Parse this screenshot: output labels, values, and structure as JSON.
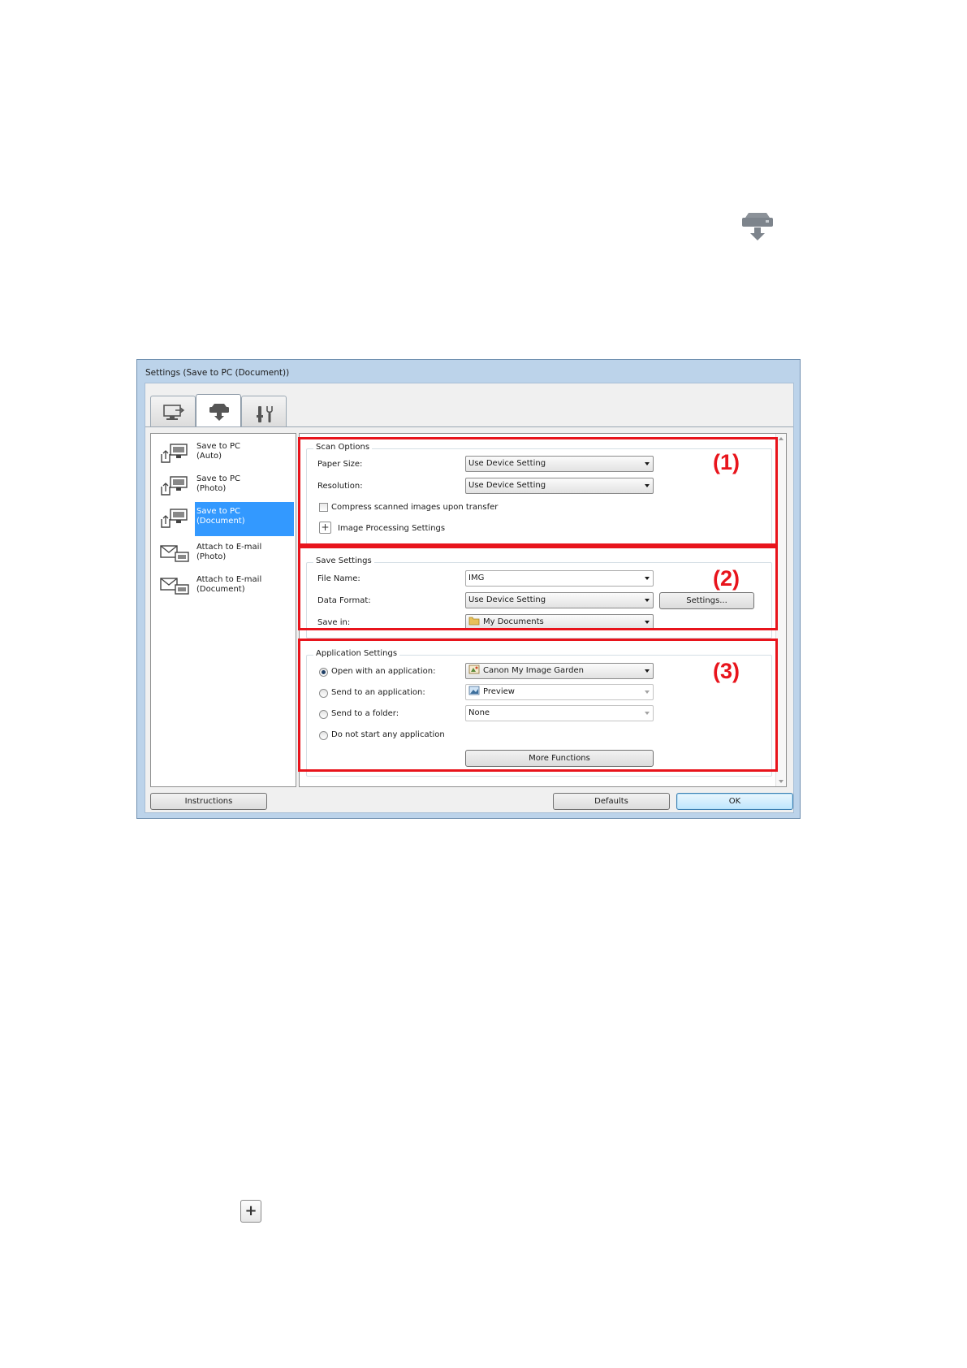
{
  "dialog": {
    "title": "Settings (Save to PC (Document))",
    "tabs": [
      {
        "name": "scan-from-computer-tab",
        "icon": "computer-scan-icon",
        "active": false
      },
      {
        "name": "scan-from-operation-panel-tab",
        "icon": "scanner-icon",
        "active": true
      },
      {
        "name": "general-settings-tab",
        "icon": "tools-icon",
        "active": false
      }
    ],
    "list": [
      {
        "label": "Save to PC\n(Auto)",
        "icon": "save-to-pc-icon"
      },
      {
        "label": "Save to PC\n(Photo)",
        "icon": "save-to-pc-icon"
      },
      {
        "label": "Save to PC\n(Document)",
        "icon": "save-to-pc-icon",
        "selected": true
      },
      {
        "label": "Attach to E-mail\n(Photo)",
        "icon": "email-icon"
      },
      {
        "label": "Attach to E-mail\n(Document)",
        "icon": "email-icon"
      }
    ],
    "scan_options": {
      "title": "Scan Options",
      "callout": "(1)",
      "paper_size_label": "Paper Size:",
      "paper_size_value": "Use Device Setting",
      "resolution_label": "Resolution:",
      "resolution_value": "Use Device Setting",
      "compress_label": "Compress scanned images upon transfer",
      "compress_checked": false,
      "image_processing_label": "Image Processing Settings"
    },
    "save_settings": {
      "title": "Save Settings",
      "callout": "(2)",
      "file_name_label": "File Name:",
      "file_name_value": "IMG",
      "data_format_label": "Data Format:",
      "data_format_value": "Use Device Setting",
      "settings_button": "Settings...",
      "save_in_label": "Save in:",
      "save_in_value": "My Documents"
    },
    "application_settings": {
      "title": "Application Settings",
      "callout": "(3)",
      "open_app_label": "Open with an application:",
      "open_app_value": "Canon My Image Garden",
      "send_app_label": "Send to an application:",
      "send_app_value": "Preview",
      "send_folder_label": "Send to a folder:",
      "send_folder_value": "None",
      "no_app_label": "Do not start any application",
      "selected_option": "open_app",
      "more_functions_button": "More Functions"
    },
    "buttons": {
      "instructions": "Instructions",
      "defaults": "Defaults",
      "ok": "OK"
    }
  },
  "colors": {
    "highlight": "#e8141c",
    "selection": "#3399ff",
    "frame": "#bcd3ea"
  }
}
